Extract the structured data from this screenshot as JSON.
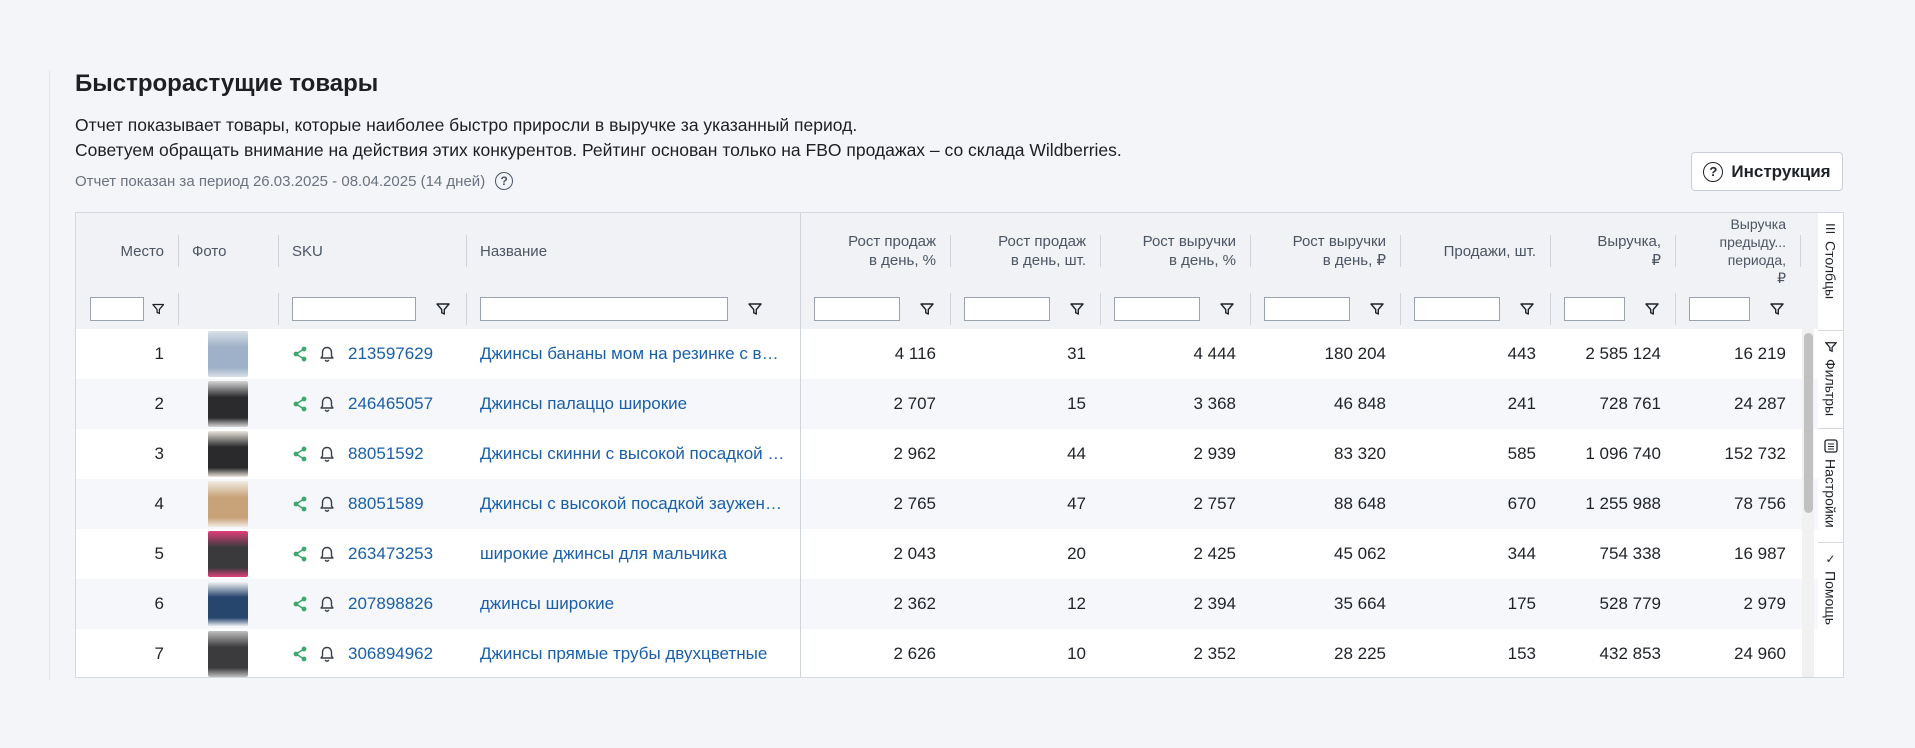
{
  "title": "Быстрорастущие товары",
  "description": [
    "Отчет показывает товары, которые наиболее быстро приросли в выручке за указанный период.",
    "Советуем обращать внимание на действия этих конкурентов. Рейтинг основан только на FBO продажах – со склада Wildberries."
  ],
  "period": "Отчет показан за период 26.03.2025 - 08.04.2025 (14 дней)",
  "help_glyph": "?",
  "instruction_button": "Инструкция",
  "columns": {
    "place": "Место",
    "photo": "Фото",
    "sku": "SKU",
    "name": "Название",
    "growth_sales_pct": [
      "Рост продаж",
      "в день, %"
    ],
    "growth_sales_pcs": [
      "Рост продаж",
      "в день, шт."
    ],
    "growth_revenue_pct": [
      "Рост выручки",
      "в день, %"
    ],
    "growth_revenue_rub": [
      "Рост выручки",
      "в день, ₽"
    ],
    "sales_pcs": "Продажи, шт.",
    "revenue": [
      "Выручка,",
      "₽"
    ],
    "revenue_prev": [
      "Выручка",
      "предыду...",
      "периода,",
      "₽"
    ]
  },
  "rows": [
    {
      "place": "1",
      "sku": "213597629",
      "name": "Джинсы бананы мом на резинке с высокой посадкой",
      "g1": "4 116",
      "g2": "31",
      "g3": "4 444",
      "g4": "180 204",
      "sales": "443",
      "rev": "2 585 124",
      "prev": "16 219",
      "photo_colors": [
        "#9fb1c8",
        "#d8dfe8"
      ]
    },
    {
      "place": "2",
      "sku": "246465057",
      "name": "Джинсы палаццо широкие",
      "g1": "2 707",
      "g2": "15",
      "g3": "3 368",
      "g4": "46 848",
      "sales": "241",
      "rev": "728 761",
      "prev": "24 287",
      "photo_colors": [
        "#2b2b2e",
        "#d6d6d6"
      ]
    },
    {
      "place": "3",
      "sku": "88051592",
      "name": "Джинсы скинни с высокой посадкой черные",
      "g1": "2 962",
      "g2": "44",
      "g3": "2 939",
      "g4": "83 320",
      "sales": "585",
      "rev": "1 096 740",
      "prev": "152 732",
      "photo_colors": [
        "#2a2a2c",
        "#e9e4dc"
      ]
    },
    {
      "place": "4",
      "sku": "88051589",
      "name": "Джинсы с высокой посадкой зауженные",
      "g1": "2 765",
      "g2": "47",
      "g3": "2 757",
      "g4": "88 648",
      "sales": "670",
      "rev": "1 255 988",
      "prev": "78 756",
      "photo_colors": [
        "#c8a37a",
        "#f2ece4"
      ]
    },
    {
      "place": "5",
      "sku": "263473253",
      "name": "широкие джинсы для мальчика",
      "g1": "2 043",
      "g2": "20",
      "g3": "2 425",
      "g4": "45 062",
      "sales": "344",
      "rev": "754 338",
      "prev": "16 987",
      "photo_colors": [
        "#3a3a3c",
        "#e0407a"
      ]
    },
    {
      "place": "6",
      "sku": "207898826",
      "name": "джинсы широкие",
      "g1": "2 362",
      "g2": "12",
      "g3": "2 394",
      "g4": "35 664",
      "sales": "175",
      "rev": "528 779",
      "prev": "2 979",
      "photo_colors": [
        "#27466e",
        "#ffffff"
      ]
    },
    {
      "place": "7",
      "sku": "306894962",
      "name": "Джинсы прямые трубы двухцветные",
      "g1": "2 626",
      "g2": "10",
      "g3": "2 352",
      "g4": "28 225",
      "sales": "153",
      "rev": "432 853",
      "prev": "24 960",
      "photo_colors": [
        "#3b3b3e",
        "#bfbfbf"
      ]
    }
  ],
  "sidebar": {
    "columns": "Столбцы",
    "filters": "Фильтры",
    "settings": "Настройки",
    "help": "Помощь"
  },
  "colors": {
    "accent_link": "#1a5fa8",
    "share_icon": "#3fa66e",
    "header_bg": "#f0f2f5"
  }
}
